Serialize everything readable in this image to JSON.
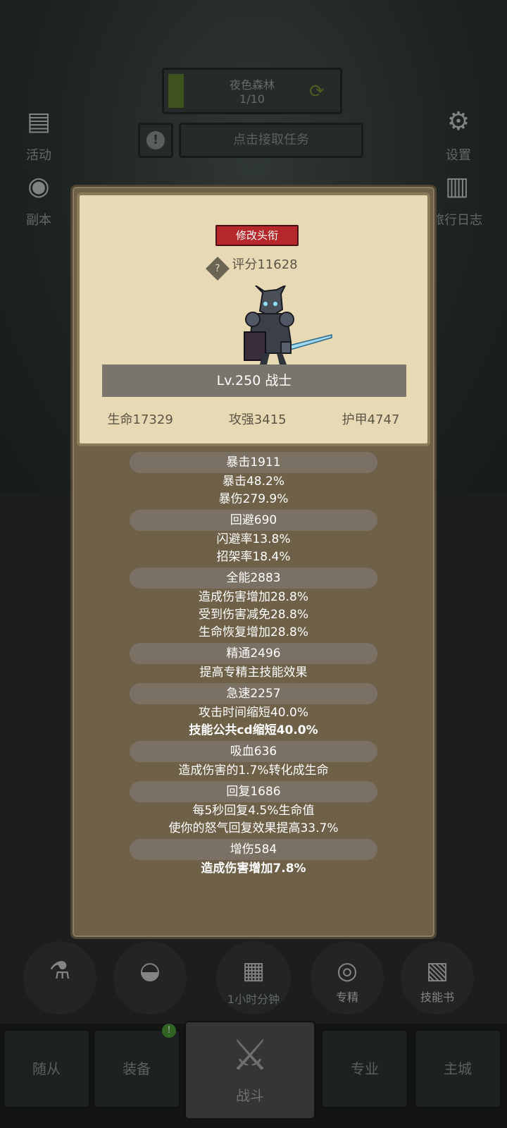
{
  "header": {
    "map_name": "夜色森林",
    "map_progress": "1/10",
    "quest_label": "点击接取任务"
  },
  "side_buttons": {
    "activity": "活动",
    "dungeon": "副本",
    "settings": "设置",
    "travel_log": "旅行日志"
  },
  "profile": {
    "edit_title_label": "修改头衔",
    "score_text": "评分11628",
    "level_class": "Lv.250 战士",
    "hp": "生命17329",
    "attack": "攻强3415",
    "armor": "护甲4747"
  },
  "stats": [
    {
      "head": "暴击1911",
      "lines": [
        "暴击48.2%",
        "暴伤279.9%"
      ]
    },
    {
      "head": "回避690",
      "lines": [
        "闪避率13.8%",
        "招架率18.4%"
      ]
    },
    {
      "head": "全能2883",
      "lines": [
        "造成伤害增加28.8%",
        "受到伤害减免28.8%",
        "生命恢复增加28.8%"
      ]
    },
    {
      "head": "精通2496",
      "lines": [
        "提高专精主技能效果"
      ]
    },
    {
      "head": "急速2257",
      "lines": [
        "攻击时间缩短40.0%",
        "技能公共cd缩短40.0%"
      ]
    },
    {
      "head": "吸血636",
      "lines": [
        "造成伤害的1.7%转化成生命"
      ]
    },
    {
      "head": "回复1686",
      "lines": [
        "每5秒回复4.5%生命值",
        "使你的怒气回复效果提高33.7%"
      ]
    },
    {
      "head": "增伤584",
      "lines": [
        "造成伤害增加7.8%"
      ]
    }
  ],
  "actions": {
    "timer": "1小时",
    "timer_suffix": "分钟",
    "specialization": "专精",
    "skill_book": "技能书",
    "chest_badge": "!"
  },
  "nav": {
    "followers": "随从",
    "equipment": "装备",
    "battle": "战斗",
    "profession": "专业",
    "main_city": "主城",
    "equipment_badge": "!"
  },
  "colors": {
    "title_button": "#b6272b",
    "card_bg": "#e6d9b4",
    "panel_bg": "#6e6148"
  }
}
